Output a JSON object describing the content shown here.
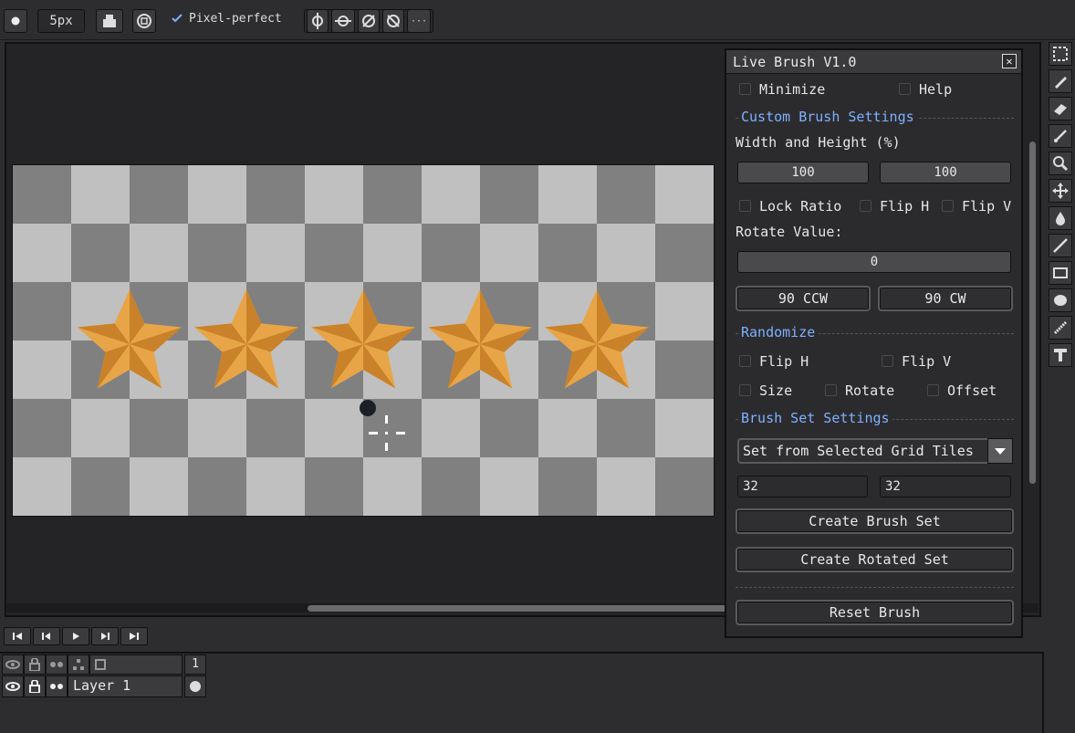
{
  "toolbar": {
    "brush_size": "5px",
    "pixel_perfect_label": "Pixel-perfect",
    "more_label": "···"
  },
  "panel": {
    "title": "Live Brush V1.0",
    "close_label": "✕",
    "minimize_label": "Minimize",
    "help_label": "Help",
    "custom_section": "Custom Brush Settings",
    "width_height_label": "Width and Height (%)",
    "width_value": "100",
    "height_value": "100",
    "lock_ratio_label": "Lock Ratio",
    "flip_h_label": "Flip H",
    "flip_v_label": "Flip V",
    "rotate_label": "Rotate Value:",
    "rotate_value": "0",
    "ccw_label": "90 CCW",
    "cw_label": "90 CW",
    "randomize_section": "Randomize",
    "rand_flip_h_label": "Flip H",
    "rand_flip_v_label": "Flip V",
    "size_label": "Size",
    "rand_rotate_label": "Rotate",
    "offset_label": "Offset",
    "brushset_section": "Brush Set Settings",
    "set_mode": "Set from Selected Grid Tiles",
    "grid_w": "32",
    "grid_h": "32",
    "create_set_label": "Create Brush Set",
    "create_rotated_label": "Create Rotated Set",
    "reset_label": "Reset Brush"
  },
  "timeline": {
    "frame_number": "1",
    "layer_name": "Layer 1"
  },
  "colors": {
    "accent": "#7fb0ff",
    "star_light": "#e8a547",
    "star_dark": "#c9822a",
    "checker_light": "#c0c0c0",
    "checker_dark": "#808080"
  },
  "icons": [
    "circle-brush-icon",
    "fill-bucket-icon",
    "pixel-perfect-icon",
    "check-icon",
    "symmetry-x-icon",
    "symmetry-y-icon",
    "symmetry-xy-icon",
    "symmetry-diag-icon",
    "marquee-icon",
    "pencil-icon",
    "eraser-icon",
    "brush-icon",
    "zoom-icon",
    "move-icon",
    "bucket-icon",
    "line-icon",
    "rectangle-icon",
    "ellipse-icon",
    "spray-icon",
    "text-icon",
    "eye-icon",
    "lock-icon",
    "link-icon"
  ]
}
